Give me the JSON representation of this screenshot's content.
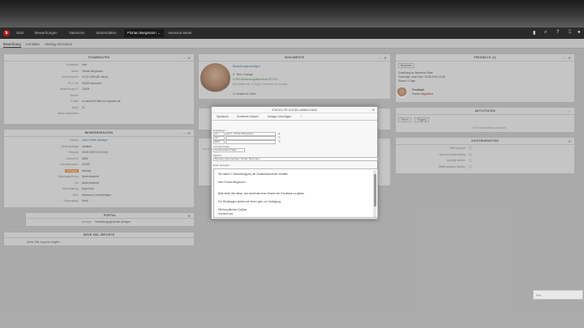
{
  "nav": {
    "logo": "b",
    "items": [
      "Start",
      "Bewerbungen",
      "Vakanzen",
      "Stammdaten"
    ],
    "active_person": "Florian Bergmann",
    "next_person": "Vanessa Meier"
  },
  "icons": [
    "bookmark-icon",
    "bookmark-icon",
    "search-icon",
    "help-icon",
    "grid-icon",
    "user-icon"
  ],
  "subnav": {
    "tabs": [
      "Bewerbung",
      "Kontakte",
      "Vertrag Versionen"
    ]
  },
  "stammdaten": {
    "title": "STAMMDATEN",
    "rows": [
      {
        "label": "Kontaktart",
        "value": "Herr"
      },
      {
        "label": "Name",
        "value": "Florian Bergmann"
      },
      {
        "label": "Geburtsdatum",
        "value": "14.10.1969 (55 Jahre)"
      },
      {
        "label": "PLZ, Ort",
        "value": "30159 Hannover"
      },
      {
        "label": "Bewerbungs-ID",
        "value": "15108"
      },
      {
        "label": "Telefon",
        "value": ""
      },
      {
        "label": "E-Mail",
        "value": "m.razny1512@b-em-systems.de"
      },
      {
        "label": "Mobil",
        "value": "01"
      },
      {
        "label": "Status bearbeiten",
        "value": ""
      }
    ]
  },
  "bewerberdaten": {
    "title": "BEWERBERDATEN",
    "rows": [
      {
        "label": "Vakanz",
        "value": "Junior Sales Manager"
      },
      {
        "label": "Stellenanzeige",
        "value": "Intrafirm"
      },
      {
        "label": "Eingang",
        "value": "19.08.2025 12:15 Uhr"
      },
      {
        "label": "Vakanz-ID",
        "value": "3559"
      },
      {
        "label": "Gehaltswunsch",
        "value": "45.000"
      },
      {
        "label": "Verfügbar ab",
        "value": "Montag"
      },
      {
        "label": "Eignungsprüfung",
        "value": "Nicht bewertet"
      },
      {
        "label": "Ort",
        "value": "Nicht bewertet"
      },
      {
        "label": "Veranstaltung",
        "value": "Anja Kuhn"
      },
      {
        "label": "Ziele",
        "value": "Montieren, Rechtfertigen"
      },
      {
        "label": "Eingangstyp",
        "value": "Mobil"
      }
    ],
    "highlight": "Verfügbar"
  },
  "portal": {
    "title": "PORTAL",
    "row_label": "Anzeige",
    "row_value": "Vorstellungsgespräch anlegen"
  },
  "import": {
    "title": "NEUE XML-IMPORTE",
    "text": "Keine XML-Importe möglich"
  },
  "dokumente": {
    "title": "DOKUMENTE",
    "link": "Bewerbungsunterlagen",
    "status": "0 - Neu / Zusage",
    "progress": "5,39% Bewerbungsabschluss 33,20%",
    "sub": "Bearbeitet seit 15 Tagen, bewertet bis Montag",
    "note": "Vorwort im Team"
  },
  "feedback": {
    "title": "FEEDBACK (1)",
    "button": "Bewerben",
    "line1": "Zustellung an Bewerber Date",
    "line2": "Gesendet: Anja Kuhn 19.08.2025 13:28",
    "line3": "Status: 5 Tage",
    "name": "Feedback",
    "sub_label": "Status:",
    "sub_value": "Abgelehnt"
  },
  "aktivitaeten": {
    "title": "AKTIVITÄTEN",
    "buttons": [
      "Termin",
      "Eingang"
    ],
    "empty": "Keine Aktivitäten vorhanden"
  },
  "sichtbarkeiten": {
    "title": "SICHTBARKEITEN",
    "rows": [
      "BBK-Analyse",
      "Internes Matchmaking",
      "Anzeige ändern",
      "Stellenangebot ändern"
    ]
  },
  "modal": {
    "title": "STATUS-LTR ZUSTELLANMELDUNG",
    "tabs": [
      "Speichern",
      "Erweiterte Ansicht",
      "Anlagen hinzufügen",
      "···"
    ],
    "empfaenger_label": "Empfänger *",
    "recipient_name": "Herr · Florian Bergmann",
    "cc_label": "CC",
    "bcc_label": "BCC",
    "sender_label": "Absender",
    "kontaktvorlage_label": "Kontaktvorlage",
    "kontaktvorlage_value": "Textbausteinvorlage",
    "betreff_label": "Betreff *",
    "betreff_value": "Bewerbungsunterlagen Florian Bergmann",
    "inhalt_label": "Datei anzeigen",
    "body": [
      "Sie haben 1 Bewerbung(en) als Zusatzdokumente erhalten",
      "Herr Florian Bergmann",
      "Bitte teilen Sie diese, uns innerhalb einer Woche ein Feedback zu geben",
      "Für Rückfragen stehen wir Ihnen gern zur Verfügung.",
      "Mit freundlichen Grüßen",
      "Konrad Kurz"
    ]
  },
  "toast": "Frei"
}
